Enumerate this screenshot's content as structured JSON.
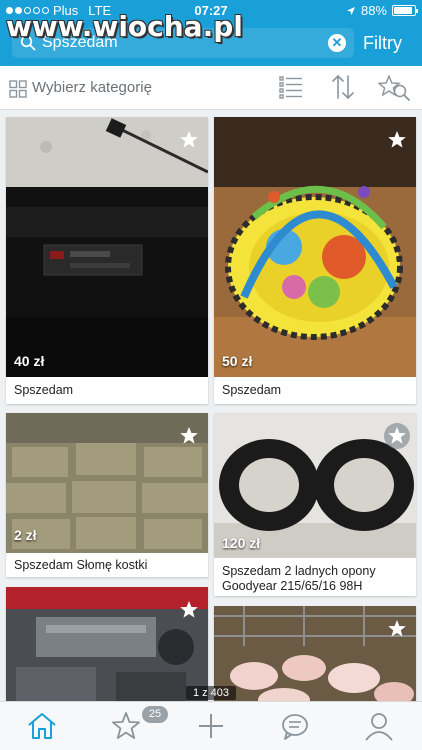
{
  "watermark": "www.wiocha.pl",
  "status_bar": {
    "carrier": "Plus",
    "network": "LTE",
    "time": "07:27",
    "battery": "88%"
  },
  "search": {
    "query": "Spszedam",
    "filters_label": "Filtry"
  },
  "toolbar": {
    "category_label": "Wybierz kategorię"
  },
  "listings": [
    {
      "price": "40 zł",
      "title": "Spszedam",
      "photo": "radio-panel"
    },
    {
      "price": "50 zł",
      "title": "Spszedam",
      "photo": "baby-play-mat"
    },
    {
      "price": "2 zł",
      "title": "Spszedam Słomę kostki",
      "photo": "hay-bales"
    },
    {
      "price": "120 zł",
      "title": "Spszedam 2 ladnych opony Goodyear 215/65/16 98H",
      "photo": "tires"
    },
    {
      "price": "",
      "title": "",
      "photo": "car-engine"
    },
    {
      "price": "",
      "title": "",
      "photo": "piglets"
    }
  ],
  "page_counter": "1 z 403",
  "tabbar": {
    "observed_badge": "25"
  },
  "colors": {
    "brand": "#1aa0d8",
    "icon_gray": "#8a949c",
    "active_tab": "#1aa0d8"
  }
}
